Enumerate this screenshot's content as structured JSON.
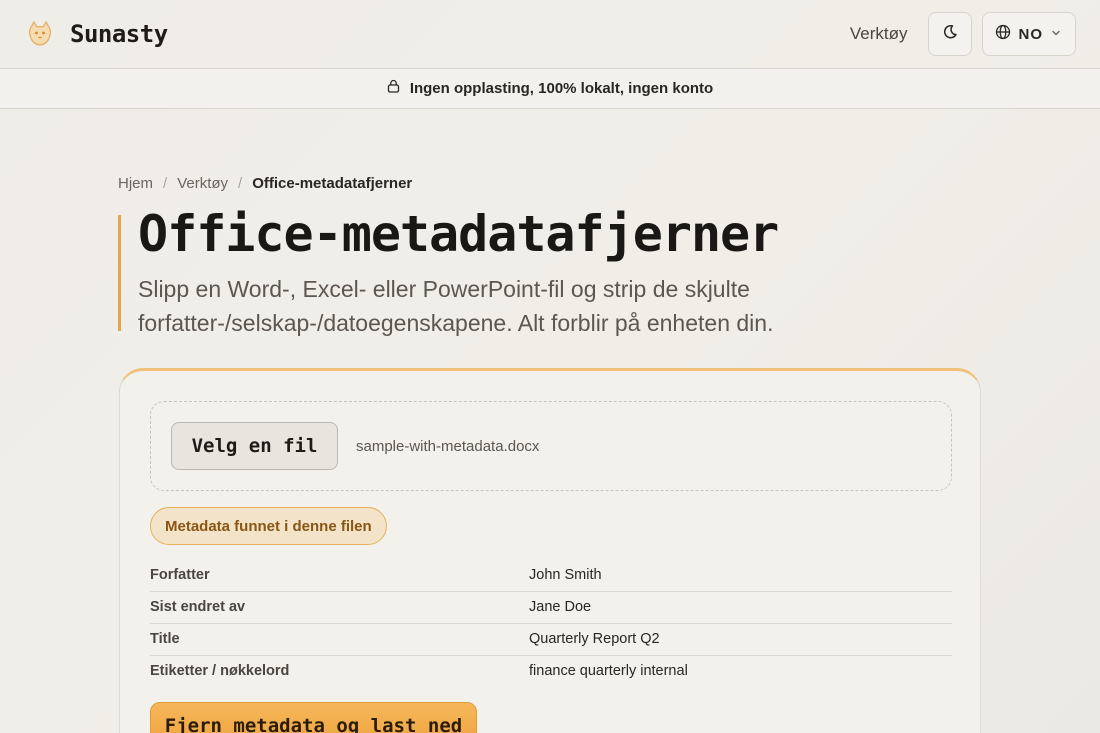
{
  "header": {
    "brand_name": "Sunasty",
    "logo_icon": "cat-icon",
    "tools_link": "Verktøy",
    "theme_icon": "moon-icon",
    "language_icon": "globe-icon",
    "language_code": "NO"
  },
  "banner": {
    "icon": "lock-icon",
    "text": "Ingen opplasting, 100% lokalt, ingen konto"
  },
  "breadcrumb": {
    "items": [
      "Hjem",
      "Verktøy",
      "Office-metadatafjerner"
    ],
    "separator": "/"
  },
  "hero": {
    "title": "Office-metadatafjerner",
    "subtitle": "Slipp en Word-, Excel- eller PowerPoint-fil og strip de skjulte forfatter-/selskap-/datoegenskapene. Alt forblir på enheten din."
  },
  "tool": {
    "choose_file_label": "Velg en fil",
    "selected_file": "sample-with-metadata.docx",
    "metadata_badge": "Metadata funnet i denne filen",
    "metadata": [
      {
        "key": "Forfatter",
        "value": "John Smith"
      },
      {
        "key": "Sist endret av",
        "value": "Jane Doe"
      },
      {
        "key": "Title",
        "value": "Quarterly Report Q2"
      },
      {
        "key": "Etiketter / nøkkelord",
        "value": "finance quarterly internal"
      }
    ],
    "remove_button": "Fjern metadata og last ned"
  },
  "colors": {
    "accent": "#eea13d",
    "accent_border": "#e9a44a",
    "badge_bg": "#f3e3c8",
    "badge_text": "#8a5613"
  }
}
